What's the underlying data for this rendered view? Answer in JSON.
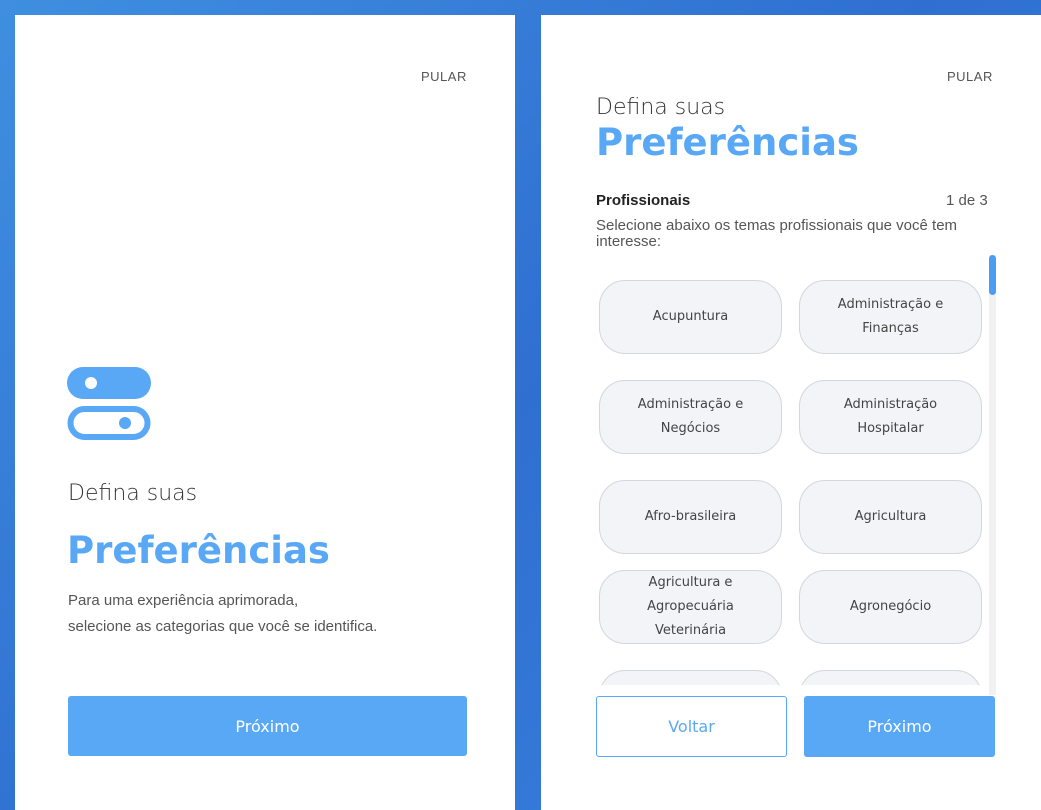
{
  "colors": {
    "accent": "#59a8f6",
    "background": "#3b86e0",
    "chip_bg": "#f3f4f8"
  },
  "left_panel": {
    "skip_label": "PULAR",
    "icon": "toggle-switches-icon",
    "title_small": "Defina suas",
    "title_big": "Preferências",
    "description_lines": [
      "Para uma experiência aprimorada,",
      "selecione as categorias que você se identifica."
    ],
    "next_label": "Próximo"
  },
  "right_panel": {
    "skip_label": "PULAR",
    "title_small": "Defina suas",
    "title_big": "Preferências",
    "section_title": "Profissionais",
    "step": "1 de 3",
    "section_description": "Selecione abaixo os temas profissionais que você tem interesse:",
    "topics": [
      "Acupuntura",
      "Administração e Finanças",
      "Administração e Negócios",
      "Administração Hospitalar",
      "Afro-brasileira",
      "Agricultura",
      "Agricultura e Agropecuária Veterinária",
      "Agronegócio",
      "",
      ""
    ],
    "back_label": "Voltar",
    "next_label": "Próximo"
  }
}
